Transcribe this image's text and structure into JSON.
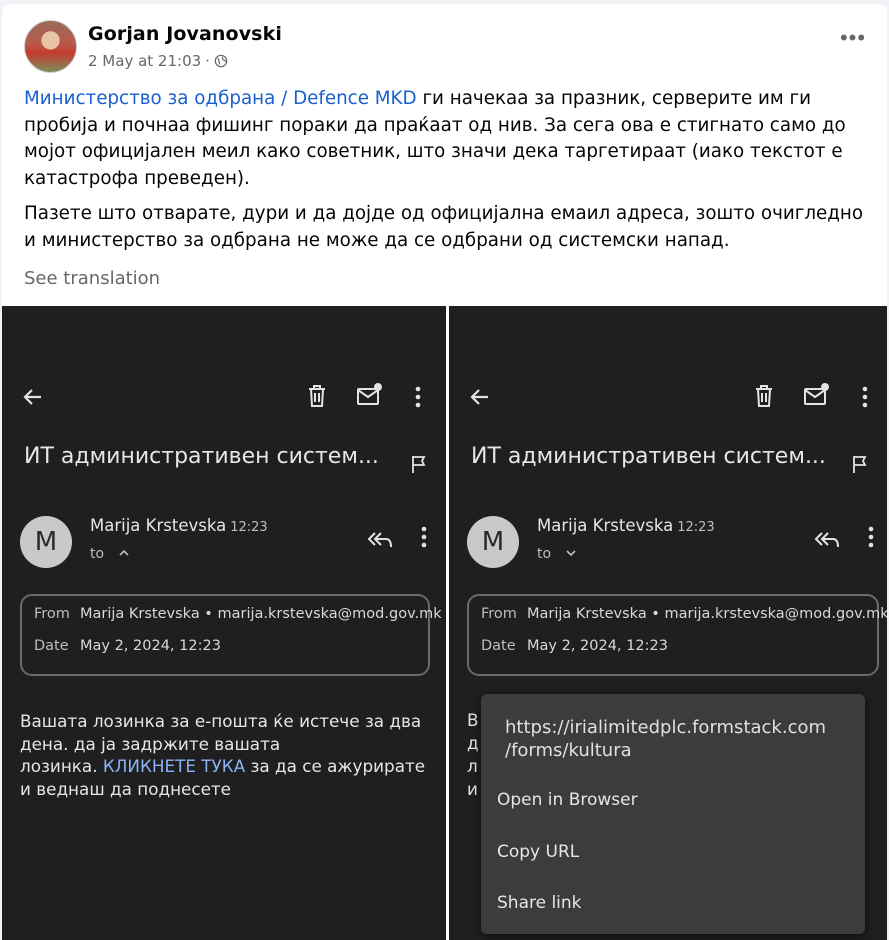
{
  "post": {
    "author": "Gorjan Jovanovski",
    "date": "2 May at 21:03",
    "dot": "·",
    "more": "•••",
    "mention": "Министерство за одбрана / Defence MKD",
    "para1_rest": " ги начекаа за празник, серверите им ги пробија и почнаа фишинг пораки да праќаат од нив. За сега ова е стигнато само до мојот официјален меил како советник, што значи дека таргетираат (иако текстот е катастрофа преведен).",
    "para2": "Пазете што отварате, дури и да дојде од официјална емаил адреса, зошто очигледно и министерство за одбрана не може да се одбрани од системски напад.",
    "see_translation": "See translation"
  },
  "email": {
    "subject": "ИТ административен систем...",
    "avatar_letter": "M",
    "sender_name": "Marija Krstevska",
    "time": "12:23",
    "to_label": "to",
    "from_key": "From",
    "from_value": "Marija Krstevska • marija.krstevska@mod.gov.mk",
    "date_key": "Date",
    "date_value": "May 2, 2024, 12:23",
    "body_line1": "Вашата лозинка за е-пошта ќе истече за два",
    "body_line2": "дена. да ја задржите вашата",
    "body_line3_pre": "лозинка. ",
    "body_link": "КЛИКНЕТЕ ТУКА",
    "body_line3_post": " за да се ажурирате",
    "body_line4": "и веднаш да поднесете",
    "partial": [
      "В",
      "д",
      "л",
      "и"
    ]
  },
  "popup": {
    "url_line1": "https://irialimitedplc.formstack.com",
    "url_line2": "/forms/kultura",
    "open": "Open in Browser",
    "copy": "Copy URL",
    "share": "Share link"
  },
  "colors": {
    "link": "#1a5fd0",
    "email_link": "#8ab4f8",
    "dark_bg": "#1f1f1f",
    "popup_bg": "#3c3c3c"
  }
}
